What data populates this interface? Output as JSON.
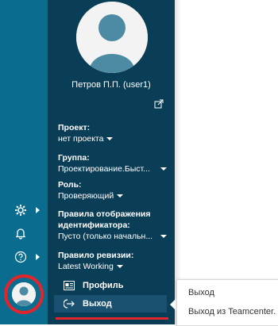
{
  "user": {
    "name": "Петров П.П. (user1)"
  },
  "fields": {
    "project": {
      "label": "Проект:",
      "value": "нет проекта"
    },
    "group": {
      "label": "Группа:",
      "value": "Проектирование.Быст..."
    },
    "role": {
      "label": "Роль:",
      "value": "Проверяющий"
    },
    "id_rules": {
      "label_line1": "Правила отображения",
      "label_line2": "идентификатора:",
      "value": "Пусто (только начальн..."
    },
    "revision_rule": {
      "label": "Правило ревизии:",
      "value": "Latest Working"
    }
  },
  "menu": {
    "profile_label": "Профиль",
    "logout_label": "Выход"
  },
  "tooltip": {
    "title": "Выход",
    "description": "Выход из Teamcenter."
  },
  "rail": {
    "icons": [
      "gear-icon",
      "bell-icon",
      "help-icon",
      "avatar"
    ]
  },
  "colors": {
    "rail": "#0a6d8f",
    "panel": "#0a3e57",
    "highlight": "#e3242b"
  }
}
